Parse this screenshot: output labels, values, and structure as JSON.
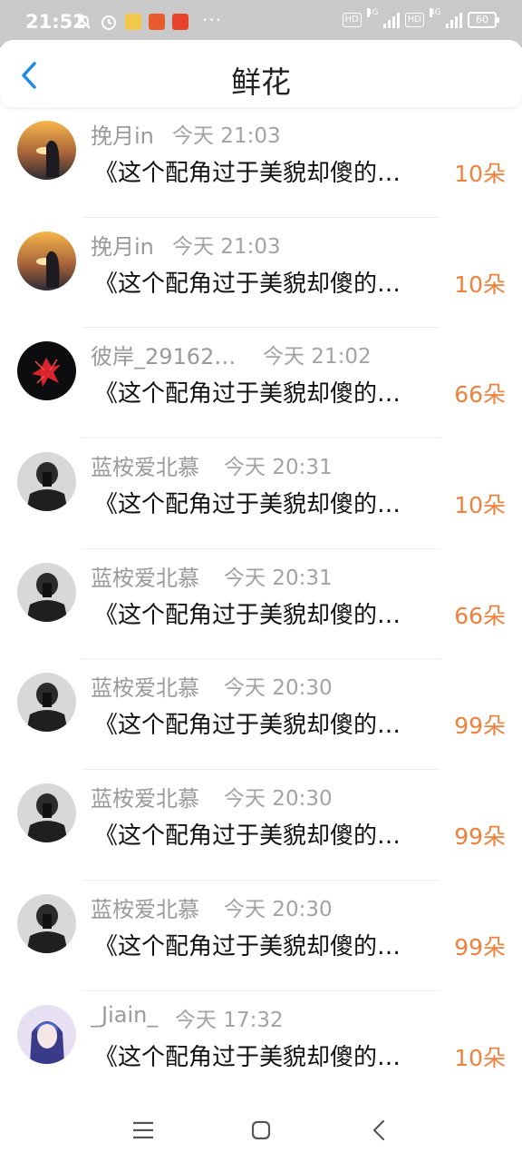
{
  "status": {
    "time": "21:52",
    "battery": "60",
    "net1": "4G",
    "net2": "4G",
    "hd1": "HD",
    "hd2": "HD"
  },
  "header": {
    "title": "鲜花",
    "back_icon": "chevron-left-icon"
  },
  "colors": {
    "accent": "#1e88e5",
    "count": "#f0813d",
    "name": "#9a9a9a"
  },
  "items": [
    {
      "name": "挽月in",
      "time": "今天 21:03",
      "message": "《这个配角过于美貌却傻的…",
      "count": "10朵"
    },
    {
      "name": "挽月in",
      "time": "今天 21:03",
      "message": "《这个配角过于美貌却傻的…",
      "count": "10朵"
    },
    {
      "name": "彼岸_29162…",
      "time": "今天 21:02",
      "message": "《这个配角过于美貌却傻的…",
      "count": "66朵"
    },
    {
      "name": "蓝桉爱北慕",
      "time": "今天 20:31",
      "message": "《这个配角过于美貌却傻的…",
      "count": "10朵"
    },
    {
      "name": "蓝桉爱北慕",
      "time": "今天 20:31",
      "message": "《这个配角过于美貌却傻的…",
      "count": "66朵"
    },
    {
      "name": "蓝桉爱北慕",
      "time": "今天 20:30",
      "message": "《这个配角过于美貌却傻的…",
      "count": "99朵"
    },
    {
      "name": "蓝桉爱北慕",
      "time": "今天 20:30",
      "message": "《这个配角过于美貌却傻的…",
      "count": "99朵"
    },
    {
      "name": "蓝桉爱北慕",
      "time": "今天 20:30",
      "message": "《这个配角过于美貌却傻的…",
      "count": "99朵"
    },
    {
      "name": "_Jiain_",
      "time": "今天 17:32",
      "message": "《这个配角过于美貌却傻的…",
      "count": "10朵"
    }
  ],
  "nav": {
    "menu_icon": "menu-icon",
    "home_icon": "home-square-icon",
    "back_icon": "back-triangle-icon"
  }
}
